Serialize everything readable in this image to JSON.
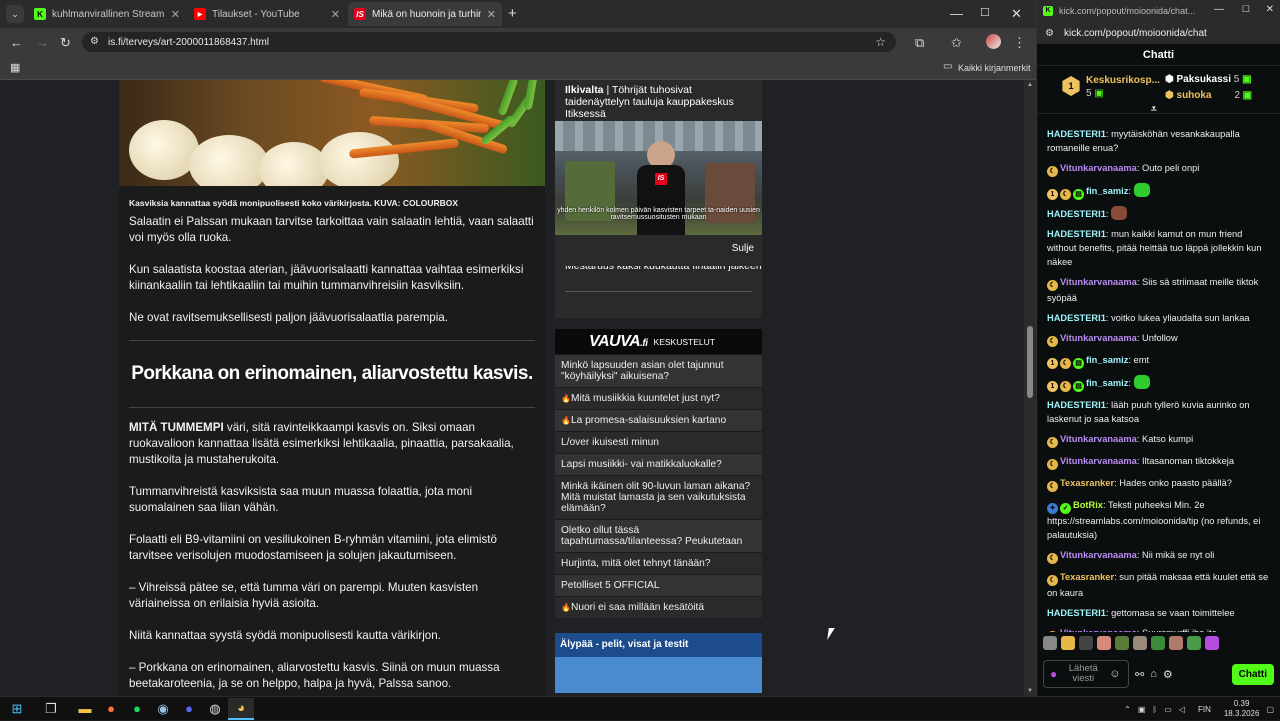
{
  "browser": {
    "tabs": [
      {
        "title": "kuhlmanvirallinen Stream - Wat",
        "favicon": "kick",
        "color": "#53fc18"
      },
      {
        "title": "Tilaukset - YouTube",
        "favicon": "youtube",
        "color": "#ff0000"
      },
      {
        "title": "Mikä on huonoin ja turhin kasvi",
        "favicon": "is",
        "color": "#e3001b"
      }
    ],
    "new_tab": "+",
    "url": "is.fi/terveys/art-2000011868437.html",
    "bookmarks_label": "Kaikki kirjanmerkit"
  },
  "article": {
    "caption": "Kasviksia kannattaa syödä monipuolisesti koko värikirjosta. KUVA: COLOURBOX",
    "p1": "Salaatin ei Palssan mukaan tarvitse tarkoittaa vain salaatin lehtiä, vaan salaatti voi myös olla ruoka.",
    "p2": "Kun salaatista koostaa aterian, jäävuorisalaatti kannattaa vaihtaa esimerkiksi kiinankaaliin tai lehtikaaliin tai muihin tummanvihreisiin kasviksiin.",
    "p3": "Ne ovat ravitsemuksellisesti paljon jäävuorisalaattia parempia.",
    "heading": "Porkkana on erinomainen, aliarvostettu kasvis.",
    "p4_bold": "MITÄ TUMMEMPI",
    "p4": " väri, sitä ravinteikkaampi kasvis on. Siksi omaan ruokavalioon kannattaa lisätä esimerkiksi lehtikaalia, pinaattia, parsakaalia, mustikoita ja mustaherukoita.",
    "p5": "Tummanvihreistä kasviksista saa muun muassa folaattia, jota moni suomalainen saa liian vähän.",
    "p6": "Folaatti eli B9-vitamiini on vesiliukoinen B-ryhmän vitamiini, jota elimistö tarvitsee verisolujen muodostamiseen ja solujen jakautumiseen.",
    "p7": "– Vihreissä pätee se, että tumma väri on parempi. Muuten kasvisten väriaineissa on erilaisia hyviä asioita.",
    "p8": "Niitä kannattaa syystä syödä monipuolisesti kautta värikirjon.",
    "p9": "– Porkkana on erinomainen, aliarvostettu kasvis. Siinä on muun muassa beetakaroteenia, ja se on helppo, halpa ja hyvä, Palssa sanoo."
  },
  "sidebar": {
    "ilkivalta_label": "Ilkivalta",
    "ilkivalta_sep": "|",
    "ilkivalta_title": "Töhrijät tuhosivat taidenäyttelyn tauluja kauppakeskus Itiksessä",
    "video_subtitle": "yhden henkilön kolmen päivän kasvisten tarpeet ta-naiden uusien ravitsemussuositusten mukaan",
    "close": "Sulje",
    "peek_text": "Mestaruus kaksi kuukautta finaalin jälkeen",
    "vauva_logo": "VAUVA",
    "vauva_logo_suffix": ".fi",
    "vauva_section": "KESKUSTELUT",
    "vauva_items": [
      {
        "text": "Minkö lapsuuden asian olet tajunnut \"köyhäilyksi\" aikuisena?",
        "hot": false
      },
      {
        "text": "Mitä musiikkia kuuntelet just nyt?",
        "hot": true
      },
      {
        "text": "La promesa-salaisuuksien kartano",
        "hot": true
      },
      {
        "text": "L/over ikuisesti minun",
        "hot": false
      },
      {
        "text": "Lapsi musiikki- vai matikkaluokalle?",
        "hot": false
      },
      {
        "text": "Minkä ikäinen olit 90-luvun laman aikana? Mitä muistat lamasta ja sen vaikutuksista elämään?",
        "hot": false
      },
      {
        "text": "Oletko ollut tässä tapahtumassa/tilanteessa? Peukutetaan",
        "hot": false
      },
      {
        "text": "Hurjinta, mitä olet tehnyt tänään?",
        "hot": false
      },
      {
        "text": "Petolliset 5 OFFICIAL",
        "hot": false
      },
      {
        "text": "Nuori ei saa millään kesätöitä",
        "hot": true
      }
    ],
    "alypaa_title": "Älypää - pelit, visat ja testit"
  },
  "chat": {
    "window_url_short": "kick.com/popout/moioonida/chat...",
    "url": "kick.com/popout/moioonida/chat",
    "header": "Chatti",
    "top_gifters": [
      {
        "rank": "1",
        "name": "Keskusrikosp...",
        "count": "5",
        "color": "#eec35f"
      },
      {
        "rank": "",
        "name": "Paksukassi",
        "count": "5",
        "color": "#ffffff"
      },
      {
        "rank": "",
        "name": "suhoka",
        "count": "2",
        "color": "#eec35f"
      }
    ],
    "messages": [
      {
        "user": "HADESTERI1",
        "cls": "c",
        "text": "myytäiskö­hän vesankakaupalla romaneille enua?",
        "badges": []
      },
      {
        "user": "Vitunkarvanaama",
        "cls": "g",
        "text": "Outo peli onpi",
        "badges": [
          "sub"
        ]
      },
      {
        "user": "fin_samiz",
        "cls": "c",
        "text": "",
        "badges": [
          "gift",
          "sub",
          "mod"
        ],
        "emote": true
      },
      {
        "user": "HADESTERI1",
        "cls": "c",
        "text": "",
        "badges": [],
        "emote": true
      },
      {
        "user": "HADESTERI1",
        "cls": "c",
        "text": "mun kaikki kamut on mun friend without benefits, pitää heittää tuo läppä jollekkin kun näkee",
        "badges": []
      },
      {
        "user": "Vitunkarvanaama",
        "cls": "g",
        "text": "Siis sä striimaat meille tiktok syöpää",
        "badges": [
          "sub"
        ]
      },
      {
        "user": "HADESTERI1",
        "cls": "c",
        "text": "voitko lukea yliaudalta sun lankaa",
        "badges": []
      },
      {
        "user": "Vitunkarvanaama",
        "cls": "g",
        "text": "Unfollow",
        "badges": [
          "sub"
        ]
      },
      {
        "user": "fin_samiz",
        "cls": "c",
        "text": "emt",
        "badges": [
          "gift",
          "sub",
          "mod"
        ]
      },
      {
        "user": "fin_samiz",
        "cls": "c",
        "text": "",
        "badges": [
          "gift",
          "sub",
          "mod"
        ],
        "emote": true
      },
      {
        "user": "HADESTERI1",
        "cls": "c",
        "text": "lääh puuh tyllerö kuvia aurinko on laskenut jo saa katsoa",
        "badges": []
      },
      {
        "user": "Vitunkarvanaama",
        "cls": "g",
        "text": "Katso kumpi",
        "badges": [
          "sub"
        ]
      },
      {
        "user": "Vitunkarvanaama",
        "cls": "g",
        "text": "Iltasanoman tiktokkeja",
        "badges": [
          "sub"
        ]
      },
      {
        "user": "Texasranker",
        "cls": "y",
        "text": "Hades onko paasto päällä?",
        "badges": [
          "sub"
        ]
      },
      {
        "user": "BotRix",
        "cls": "l",
        "text": "Teksti puheeksi Min. 2e https://streamlabs.com/moioonida/tip (no refunds, ei palautuksia)",
        "badges": [
          "bot",
          "verified"
        ]
      },
      {
        "user": "Vitunkarvanaama",
        "cls": "g",
        "text": "Nii mikä se nyt oli",
        "badges": [
          "sub"
        ]
      },
      {
        "user": "Texasranker",
        "cls": "y",
        "text": "sun pitää maksaa että kuulet että se on kaura",
        "badges": [
          "sub"
        ]
      },
      {
        "user": "HADESTERI1",
        "cls": "c",
        "text": "gettomasa se vaan toimittelee",
        "badges": []
      },
      {
        "user": "Vitunkarvanaama",
        "cls": "g",
        "text": "Suursmurffi iha ite",
        "badges": [
          "sub"
        ]
      }
    ],
    "input_placeholder": "Lähetä viesti",
    "send_button": "Chatti"
  },
  "taskbar": {
    "language": "FIN",
    "time": "0.39",
    "date": "18.3.2026"
  }
}
